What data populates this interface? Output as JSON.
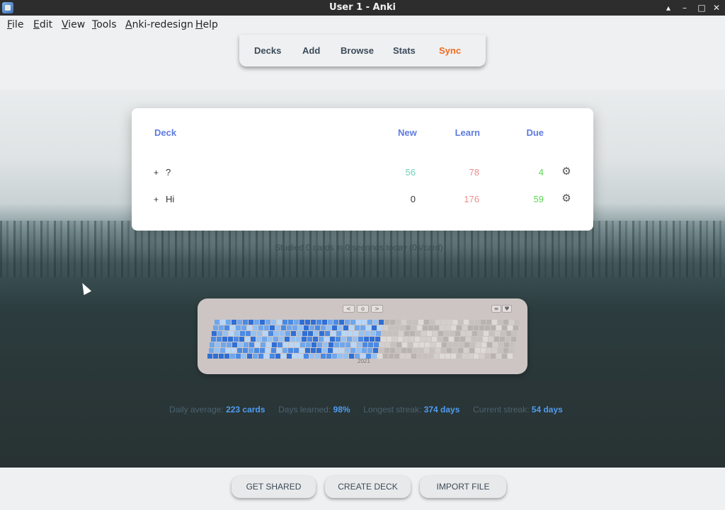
{
  "window": {
    "title": "User 1 - Anki",
    "icon": "anki-app-icon",
    "controls": [
      "minimize-icon",
      "maximize-icon",
      "close-icon"
    ]
  },
  "menubar": {
    "items": [
      {
        "label": "File",
        "mnemonic": "F",
        "rest": "ile"
      },
      {
        "label": "Edit",
        "mnemonic": "E",
        "rest": "dit"
      },
      {
        "label": "View",
        "mnemonic": "V",
        "rest": "iew"
      },
      {
        "label": "Tools",
        "mnemonic": "T",
        "rest": "ools"
      },
      {
        "label": "Anki-redesign",
        "mnemonic": "A",
        "rest": "nki-redesign"
      },
      {
        "label": "Help",
        "mnemonic": "H",
        "rest": "elp"
      }
    ]
  },
  "toolbar": {
    "items": [
      "Decks",
      "Add",
      "Browse",
      "Stats",
      "Sync"
    ],
    "sync_color": "#f06a20"
  },
  "decks": {
    "headers": {
      "deck": "Deck",
      "new": "New",
      "learn": "Learn",
      "due": "Due"
    },
    "rows": [
      {
        "expander": "+",
        "name": "?",
        "new": "56",
        "learn": "78",
        "due": "4"
      },
      {
        "expander": "+",
        "name": "Hi",
        "new": "0",
        "learn": "176",
        "due": "59"
      }
    ],
    "colors": {
      "header": "#5e7be0",
      "new": "#6fcfb9",
      "new_zero": "#333333",
      "learn": "#f08e8e",
      "due": "#59d84f"
    }
  },
  "studied": "Studied 0 cards in 0 seconds today (0s/card)",
  "heatmap": {
    "nav": {
      "prev": "<",
      "today": "o",
      "next": ">"
    },
    "year_label": "2021",
    "active_fraction": 0.56,
    "palette": [
      "#2f6fd6",
      "#4a8ae4",
      "#6fa6ec",
      "#95c0f2",
      "#b9d6f6"
    ],
    "empty_color": "#b8b3b1"
  },
  "stats": {
    "daily_average_label": "Daily average:",
    "daily_average": "223 cards",
    "days_learned_label": "Days learned:",
    "days_learned": "98%",
    "longest_streak_label": "Longest streak:",
    "longest_streak": "374 days",
    "current_streak_label": "Current streak:",
    "current_streak": "54 days"
  },
  "bottom": {
    "get_shared": "GET SHARED",
    "create_deck": "CREATE DECK",
    "import_file": "IMPORT FILE"
  }
}
